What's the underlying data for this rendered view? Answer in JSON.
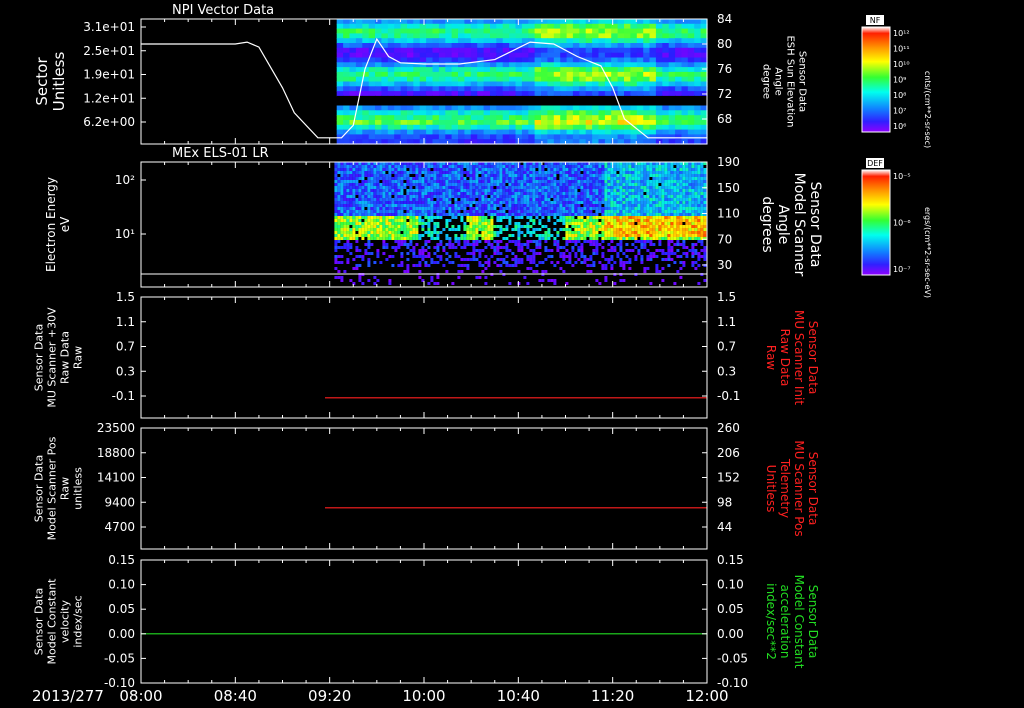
{
  "colors": {
    "background": "#000000",
    "foreground": "#ffffff",
    "red_trace": "#ff2020",
    "green_trace": "#22dd22"
  },
  "colorbars": [
    {
      "label": "NF",
      "unit": "cnts/(cm**2-sr-sec)",
      "ticks": [
        "10¹²",
        "10¹¹",
        "10¹⁰",
        "10⁹",
        "10⁸",
        "10⁷",
        "10⁶"
      ]
    },
    {
      "label": "DEF",
      "unit": "ergs/(cm**2-sr-sec-eV)",
      "ticks": [
        "10⁻⁵",
        "10⁻⁶",
        "10⁻⁷"
      ]
    }
  ],
  "time_axis": {
    "date_label": "2013/277",
    "ticks": [
      "08:00",
      "08:40",
      "09:20",
      "10:00",
      "10:40",
      "11:20",
      "12:00"
    ],
    "range": [
      "08:00",
      "12:00"
    ]
  },
  "chart_data": [
    {
      "type": "heatmap",
      "title": "NPI Vector Data",
      "ylabel": "Sector\nUnitless",
      "yticks": [
        "3.1e+01",
        "2.5e+01",
        "1.9e+01",
        "1.2e+01",
        "6.2e+00"
      ],
      "right_ylabel": "Sensor Data\nESH Sun Elevation\nAngle\ndegree",
      "right_yticks": [
        "84",
        "80",
        "76",
        "72",
        "68"
      ],
      "right_ylim": [
        64,
        84
      ],
      "data_start": "09:23",
      "overlay_line": {
        "x": [
          "08:00",
          "08:30",
          "08:40",
          "08:45",
          "08:50",
          "09:00",
          "09:05",
          "09:15",
          "09:25",
          "09:30",
          "09:35",
          "09:40",
          "09:45",
          "09:50",
          "10:00",
          "10:15",
          "10:30",
          "10:45",
          "10:55",
          "11:05",
          "11:15",
          "11:20",
          "11:25",
          "11:35",
          "12:00"
        ],
        "y": [
          80.0,
          80.0,
          80.0,
          80.3,
          79.5,
          73.0,
          69.0,
          65.0,
          65.0,
          67.0,
          76.0,
          80.8,
          78.0,
          77.0,
          76.8,
          76.8,
          77.5,
          80.3,
          80.0,
          78.0,
          76.5,
          73.0,
          68.0,
          65.0,
          65.0
        ]
      }
    },
    {
      "type": "heatmap",
      "title": "MEx ELS-01 LR",
      "ylabel": "Electron Energy\neV",
      "yticks": [
        "10²",
        "10¹"
      ],
      "right_ylabel": "Sensor Data\nModel Scanner\nAngle\ndegrees",
      "right_yticks": [
        "190",
        "150",
        "110",
        "70",
        "30"
      ],
      "data_start": "09:22"
    },
    {
      "type": "line",
      "ylabel": "Sensor Data\nMU Scanner +30V\nRaw Data\nRaw",
      "yticks": [
        "1.5",
        "1.1",
        "0.7",
        "0.3",
        "-0.1"
      ],
      "ylim": [
        -0.3,
        1.5
      ],
      "right_ylabel": "Sensor Data\nMU Scanner Init\nRaw Data\nRaw",
      "right_yticks": [
        "1.5",
        "1.1",
        "0.7",
        "0.3",
        "-0.1"
      ],
      "series": [
        {
          "x": [
            "09:18",
            "12:00"
          ],
          "y": [
            0.0,
            0.0
          ]
        }
      ]
    },
    {
      "type": "line",
      "ylabel": "Sensor Data\nModel Scanner Pos\nRaw\nunitless",
      "yticks": [
        "23500",
        "18800",
        "14100",
        "9400",
        "4700"
      ],
      "ylim": [
        0,
        23500
      ],
      "right_ylabel": "Sensor Data\nMU Scanner Pos\nTelemetry\nUnitless",
      "right_yticks": [
        "260",
        "206",
        "152",
        "98",
        "44"
      ],
      "series": [
        {
          "x": [
            "09:18",
            "12:00"
          ],
          "y": [
            8000,
            8000
          ]
        }
      ]
    },
    {
      "type": "line",
      "ylabel": "Sensor Data\nModel Constant\nvelocity\nindex/sec",
      "yticks": [
        "0.15",
        "0.10",
        "0.05",
        "0.00",
        "-0.05",
        "-0.10"
      ],
      "ylim": [
        -0.1,
        0.15
      ],
      "right_ylabel": "Sensor Data\nModel Constant\nacceleration\nindex/sec**2",
      "right_yticks": [
        "0.15",
        "0.10",
        "0.05",
        "0.00",
        "-0.05",
        "-0.10"
      ],
      "series": [
        {
          "x": [
            "08:00",
            "12:00"
          ],
          "y": [
            0.0,
            0.0
          ]
        }
      ]
    }
  ]
}
